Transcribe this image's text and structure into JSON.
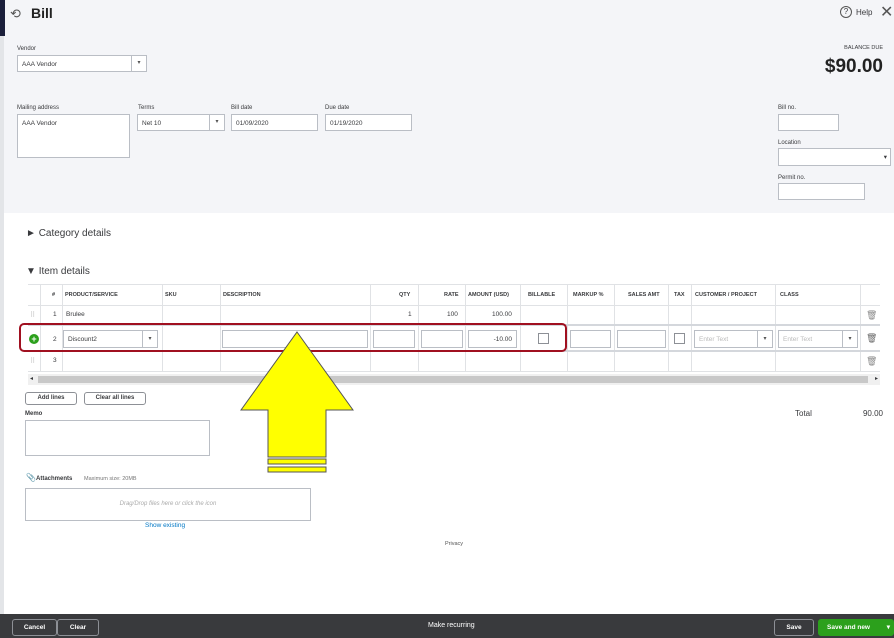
{
  "header": {
    "title": "Bill",
    "help": "Help",
    "balance_due_label": "BALANCE DUE",
    "balance_due": "$90.00"
  },
  "form": {
    "vendor_label": "Vendor",
    "vendor": "AAA Vendor",
    "mailing_label": "Mailing address",
    "mailing": "AAA Vendor",
    "terms_label": "Terms",
    "terms": "Net 10",
    "bill_date_label": "Bill date",
    "bill_date": "01/09/2020",
    "due_date_label": "Due date",
    "due_date": "01/19/2020",
    "bill_no_label": "Bill no.",
    "location_label": "Location",
    "permit_label": "Permit no."
  },
  "sections": {
    "category": "Category details",
    "item": "Item details"
  },
  "table": {
    "headers": [
      "#",
      "PRODUCT/SERVICE",
      "SKU",
      "DESCRIPTION",
      "QTY",
      "RATE",
      "AMOUNT (USD)",
      "BILLABLE",
      "MARKUP %",
      "SALES AMT",
      "TAX",
      "CUSTOMER / PROJECT",
      "CLASS"
    ],
    "rows": [
      {
        "num": "1",
        "product": "Brulee",
        "qty": "1",
        "rate": "100",
        "amount": "100.00"
      },
      {
        "num": "2",
        "product": "Discount2",
        "amount": "-10.00",
        "customer_placeholder": "Enter Text",
        "class_placeholder": "Enter Text"
      },
      {
        "num": "3"
      }
    ]
  },
  "buttons": {
    "add_lines": "Add lines",
    "clear_lines": "Clear all lines"
  },
  "total_label": "Total",
  "total": "90.00",
  "memo_label": "Memo",
  "attachments": {
    "label": "Attachments",
    "max": "Maximum size: 20MB",
    "drop": "Drag/Drop files here or click the icon",
    "show_existing": "Show existing"
  },
  "privacy": "Privacy",
  "footer": {
    "cancel": "Cancel",
    "clear": "Clear",
    "recurring": "Make recurring",
    "save": "Save",
    "save_new": "Save and new"
  },
  "colors": {
    "green": "#2ca01c",
    "highlight": "#a01020",
    "arrow": "#ffff00"
  }
}
